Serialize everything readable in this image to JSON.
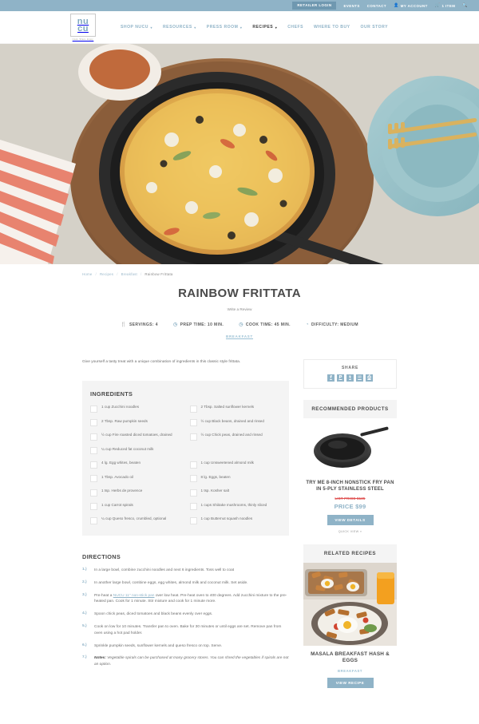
{
  "topbar": {
    "retailer_login": "RETAILER LOGIN",
    "events": "EVENTS",
    "contact": "CONTACT",
    "my_account": "MY ACCOUNT",
    "cart": "1 ITEM"
  },
  "brand": {
    "line1": "nu",
    "line2": "cu",
    "tagline": "Cook. Share. Enjoy."
  },
  "nav": {
    "items": [
      {
        "label": "SHOP NUCU",
        "caret": "▾"
      },
      {
        "label": "RESOURCES",
        "caret": "▾"
      },
      {
        "label": "PRESS ROOM",
        "caret": "▾"
      },
      {
        "label": "RECIPES",
        "caret": "▾"
      },
      {
        "label": "CHEFS",
        "caret": ""
      },
      {
        "label": "WHERE TO BUY",
        "caret": ""
      },
      {
        "label": "OUR STORY",
        "caret": ""
      }
    ]
  },
  "breadcrumb": {
    "home": "Home",
    "recipes": "Recipes",
    "breakfast": "Breakfast",
    "current": "Rainbow Frittata"
  },
  "recipe": {
    "title": "RAINBOW FRITTATA",
    "review_link": "Write a Review",
    "category": "BREAKFAST",
    "intro": "Give yourself a tasty treat with a unique combination of ingredients in this classic style frittata.",
    "meta": [
      {
        "icon": "🍴",
        "label": "SERVINGS: 4"
      },
      {
        "icon": "◷",
        "label": "PREP TIME: 10 MIN."
      },
      {
        "icon": "◷",
        "label": "COOK TIME: 45 MIN."
      },
      {
        "icon": "◔",
        "label": "DIFFICULTY: MEDIUM"
      }
    ]
  },
  "ingredients": {
    "heading": "INGREDIENTS",
    "left": [
      "1 cup Zucchini noodles",
      "2 Tbsp. Raw pumpkin seeds",
      "½ cup Fire roasted diced tomatoes, drained",
      "¼ cup Reduced fat coconut milk",
      "4 lg. Egg whites, beaten",
      "1 Tbsp. Avocado oil",
      "1 tsp. Herbs de provence",
      "1 cup Carrot spirals",
      "¼ cup Queso fresco, crumbled, optional"
    ],
    "right": [
      "2 Tbsp. Salted sunflower kernels",
      "½ cup Black beans, drained and rinsed",
      "½ cup Chick peas, drained and rinsed",
      "1 cup Unsweetened almond milk",
      "8 lg. Eggs, beaten",
      "1 tsp. Kosher salt",
      "1 cups Shiitake mushrooms, thinly sliced",
      "1 cup Butternut squash noodles"
    ]
  },
  "directions": {
    "heading": "DIRECTIONS",
    "steps": [
      {
        "num": "1.)",
        "text": "In a large bowl, combine zucchini noodles and next 6 ingredients. Toss well to coat"
      },
      {
        "num": "2.)",
        "text": "In another large bowl, combine eggs, egg whites, almond milk and coconut milk.  Set aside."
      },
      {
        "num": "3.)",
        "pre": "Pre-heat a ",
        "link": "NUCU 11\" non-stick pan",
        "post": " over low heat. Pre-heat oven to 400 degrees. Add zucchini mixture to the pre-heated pan. Cook for 1 minute. Stir mixture and cook for 1 minute more."
      },
      {
        "num": "4.)",
        "text": "Spoon chick peas, diced tomatoes and black beans evenly over eggs."
      },
      {
        "num": "5.)",
        "text": "Cook on low for 10 minutes. Transfer pan to oven. Bake for 30 minutes or until eggs are set. Remove pan from oven using a hot pad holder."
      },
      {
        "num": "6.)",
        "text": "Sprinkle pumpkin seeds, sunflower kernels and queso fresco on top. Serve."
      },
      {
        "num": "7.)",
        "note_label": "Notes:",
        "text": " Vegetable spirals can be purchased at many grocery stores.  You can shred the vegetables if spirals are not an option."
      }
    ]
  },
  "share": {
    "title": "SHARE",
    "icons": [
      {
        "name": "facebook-icon",
        "glyph": "f"
      },
      {
        "name": "pinterest-icon",
        "glyph": "P"
      },
      {
        "name": "twitter-icon",
        "glyph": "t"
      },
      {
        "name": "email-icon",
        "glyph": "✉"
      },
      {
        "name": "print-icon",
        "glyph": "⎙"
      }
    ]
  },
  "recommended": {
    "heading": "RECOMMENDED PRODUCTS",
    "product_title": "TRY ME 8-INCH NONSTICK FRY PAN IN 5-PLY STAINLESS STEEL",
    "list_price": "LIST PRICE $135",
    "price": "PRICE $99",
    "view_details": "VIEW DETAILS",
    "quick_view": "QUICK VIEW »"
  },
  "related": {
    "heading": "RELATED RECIPES",
    "recipe_title": "MASALA BREAKFAST HASH & EGGS",
    "category": "BREAKFAST",
    "view_recipe": "VIEW RECIPE"
  },
  "colors": {
    "accent": "#8fb3c7",
    "light_accent": "#9bc0d4",
    "sale_red": "#e05252",
    "panel_bg": "#f4f4f4"
  }
}
